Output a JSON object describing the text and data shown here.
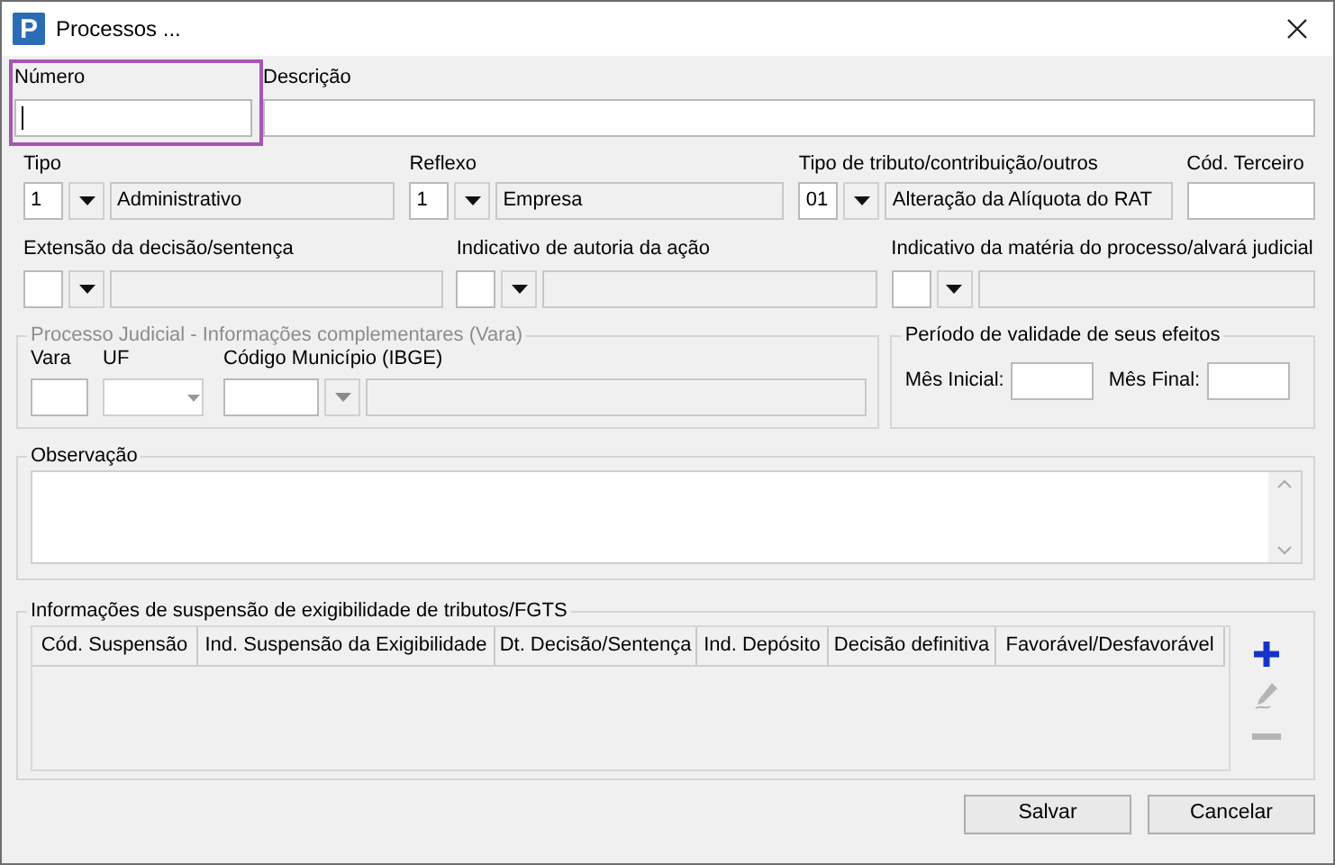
{
  "window": {
    "title": "Processos ...",
    "logo_letter": "P"
  },
  "numero": {
    "label": "Número",
    "focused": true
  },
  "descricao": {
    "label": "Descrição"
  },
  "row_2": [
    {
      "kind": "lookup",
      "label": "Tipo",
      "code": "1",
      "description": "Administrativo"
    },
    {
      "kind": "lookup",
      "label": "Reflexo",
      "code": "1",
      "description": "Empresa"
    },
    {
      "kind": "lookup",
      "label": "Tipo de tributo/contribuição/outros",
      "code": "01",
      "description": "Alteração da Alíquota do RAT"
    },
    {
      "kind": "text",
      "label": "Cód. Terceiro"
    }
  ],
  "row_3": [
    {
      "kind": "lookup",
      "label": "Extensão da decisão/sentença"
    },
    {
      "kind": "lookup",
      "label": "Indicativo de autoria da ação"
    },
    {
      "kind": "lookup",
      "label": "Indicativo da matéria do processo/alvará judicial"
    }
  ],
  "processo_judicial": {
    "legend": "Processo Judicial - Informações complementares (Vara)",
    "disabled": true,
    "fields": [
      {
        "kind": "text",
        "label": "Vara"
      },
      {
        "kind": "select",
        "label": "UF"
      },
      {
        "kind": "lookup",
        "label": "Código Município (IBGE)"
      }
    ]
  },
  "periodo": {
    "legend": "Período de validade de seus efeitos",
    "fields": [
      {
        "label": "Mês Inicial:"
      },
      {
        "label": "Mês Final:"
      }
    ]
  },
  "observacao": {
    "legend": "Observação"
  },
  "suspensao": {
    "legend": "Informações de suspensão de exigibilidade de tributos/FGTS",
    "columns": [
      "Cód. Suspensão",
      "Ind. Suspensão da Exigibilidade",
      "Dt. Decisão/Sentença",
      "Ind. Depósito",
      "Decisão definitiva",
      "Favorável/Desfavorável"
    ],
    "actions": [
      {
        "kind": "add",
        "disabled": false
      },
      {
        "kind": "edit",
        "disabled": true
      },
      {
        "kind": "remove",
        "disabled": true
      }
    ]
  },
  "buttons": [
    "Salvar",
    "Cancelar"
  ]
}
